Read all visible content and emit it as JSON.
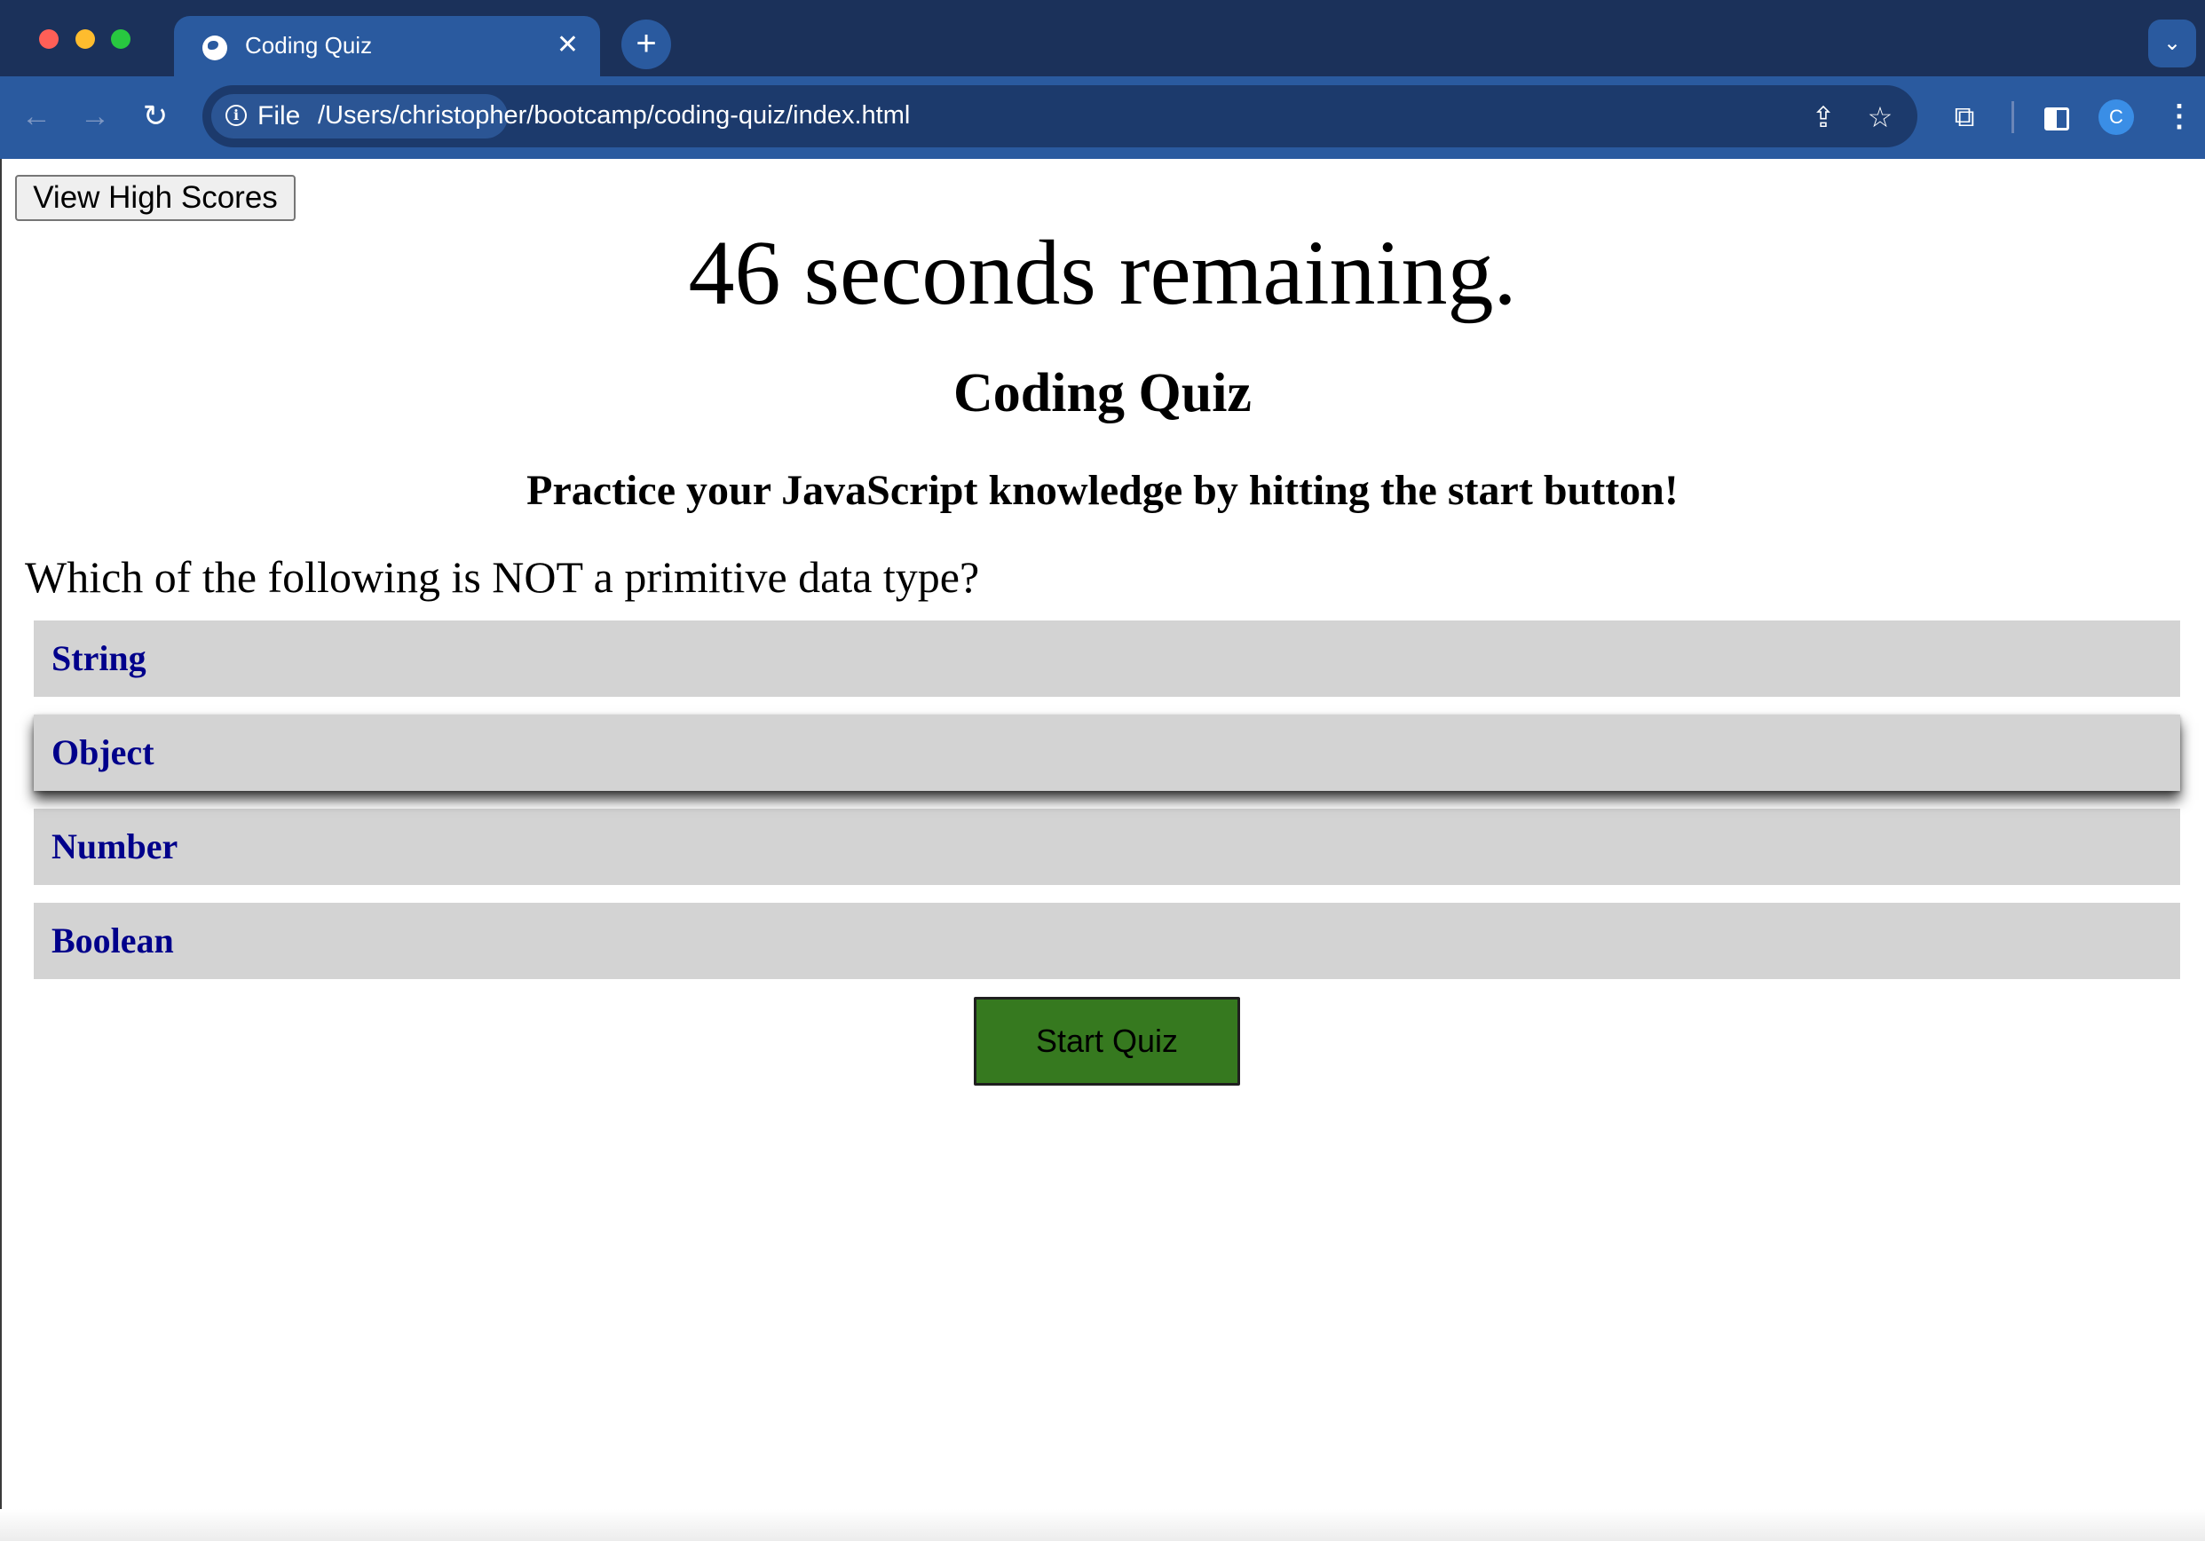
{
  "browser": {
    "tab_title": "Coding Quiz",
    "tab_close_glyph": "✕",
    "new_tab_glyph": "+",
    "tab_search_glyph": "⌄",
    "back_glyph": "←",
    "forward_glyph": "→",
    "reload_glyph": "↻",
    "file_label": "File",
    "url": "/Users/christopher/bootcamp/coding-quiz/index.html",
    "share_glyph": "⇪",
    "star_glyph": "☆",
    "extensions_glyph": "⧉",
    "avatar_initial": "C",
    "menu_glyph": "⋮",
    "icons": [
      "globe-icon",
      "info-icon",
      "share-icon",
      "star-icon",
      "puzzle-icon",
      "side-panel-icon",
      "kebab-menu-icon"
    ]
  },
  "page": {
    "high_scores_label": "View High Scores",
    "timer_text": "46 seconds remaining.",
    "title": "Coding Quiz",
    "subtitle": "Practice your JavaScript knowledge by hitting the start button!",
    "question": "Which of the following is NOT a primitive data type?",
    "answers": [
      "String",
      "Object",
      "Number",
      "Boolean"
    ],
    "start_label": "Start Quiz",
    "colors": {
      "answer_bg": "#d3d3d3",
      "answer_text": "#00008b",
      "start_bg": "#36791f",
      "chrome_toolbar": "#2a5a9f"
    }
  }
}
